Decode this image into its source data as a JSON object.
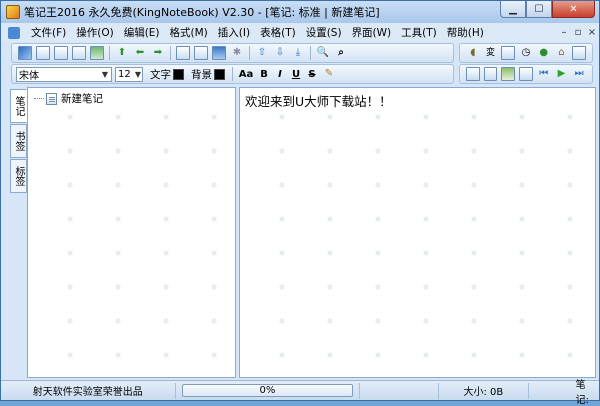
{
  "window": {
    "title": "笔记王2016 永久免费(KingNoteBook) V2.30 - [笔记: 标准 | 新建笔记]"
  },
  "menu": {
    "items": [
      "文件(F)",
      "操作(O)",
      "编辑(E)",
      "格式(M)",
      "插入(I)",
      "表格(T)",
      "设置(S)",
      "界面(W)",
      "工具(T)",
      "帮助(H)"
    ]
  },
  "format_toolbar": {
    "font": "宋体",
    "size": "12",
    "text_color_label": "文字",
    "bg_color_label": "背景",
    "text_color": "#000000",
    "bg_color": "#000000",
    "buttons": {
      "aa": "Aa",
      "bold": "B",
      "italic": "I",
      "underline": "U",
      "strike": "S"
    }
  },
  "side_tabs": [
    "笔记",
    "书签",
    "标签"
  ],
  "tree": {
    "items": [
      {
        "label": "新建笔记"
      }
    ]
  },
  "editor": {
    "content": "欢迎来到U大师下载站！！"
  },
  "status": {
    "credits": "射天软件实验室荣誉出品",
    "progress_text": "0%",
    "progress_value": 0,
    "size": "大小: 0B",
    "note_label": "笔记:"
  }
}
